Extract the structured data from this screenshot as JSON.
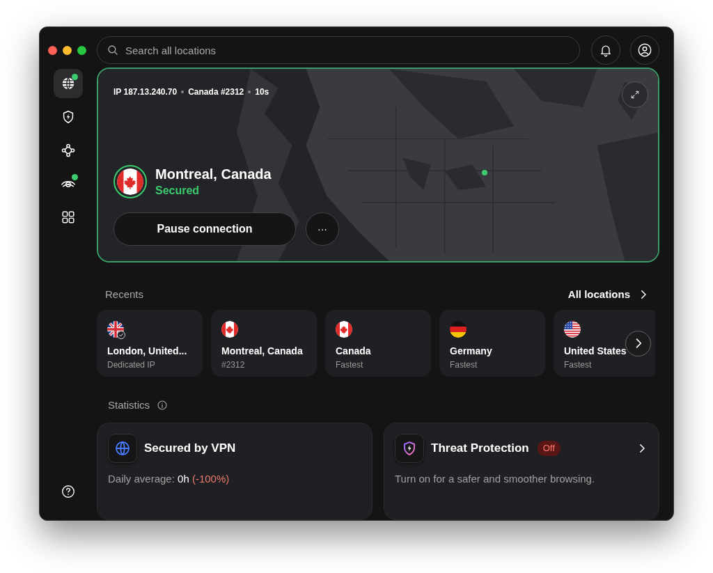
{
  "search": {
    "placeholder": "Search all locations"
  },
  "sidebar": {
    "items": [
      {
        "kind": "globe",
        "selected": true,
        "badge": true
      },
      {
        "kind": "shield",
        "selected": false,
        "badge": false
      },
      {
        "kind": "mesh",
        "selected": false,
        "badge": false
      },
      {
        "kind": "eye",
        "selected": false,
        "badge": true
      },
      {
        "kind": "grid",
        "selected": false,
        "badge": false
      }
    ]
  },
  "connection": {
    "ip": "IP 187.13.240.70",
    "server": "Canada #2312",
    "duration": "10s",
    "location": "Montreal, Canada",
    "flag": {
      "kind": "canada"
    },
    "status": "Secured",
    "connected": true,
    "pause_button": "Pause connection",
    "more_button": "···"
  },
  "recents": {
    "title": "Recents",
    "link": "All locations",
    "items": [
      {
        "name": "London, United...",
        "detail": "Dedicated IP",
        "kind": "uk",
        "dedicated": true
      },
      {
        "name": "Montreal, Canada",
        "detail": "#2312",
        "kind": "canada",
        "dedicated": false
      },
      {
        "name": "Canada",
        "detail": "Fastest",
        "kind": "canada",
        "dedicated": false
      },
      {
        "name": "Germany",
        "detail": "Fastest",
        "kind": "germany",
        "dedicated": false
      },
      {
        "name": "United States",
        "detail": "Fastest",
        "kind": "usa",
        "dedicated": false
      }
    ]
  },
  "statistics": {
    "title": "Statistics",
    "cards": [
      {
        "kind": "vpn",
        "title": "Secured by VPN",
        "text": "Daily average: ",
        "value": "0h",
        "change": "(-100%)"
      },
      {
        "kind": "threat",
        "title": "Threat Protection",
        "badge": "Off",
        "text": "Turn on for a safer and smoother browsing."
      }
    ]
  }
}
